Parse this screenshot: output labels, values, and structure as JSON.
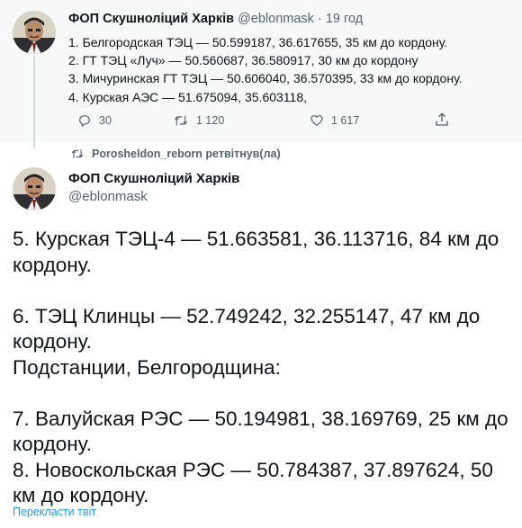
{
  "tweet1": {
    "display_name": "ФОП Скушноліций Харків",
    "handle": "@eblonmask",
    "separator": "·",
    "time": "19 год",
    "lines": [
      "1. Белгородская ТЭЦ — 50.599187, 36.617655, 35 км до кордону.",
      "2. ГТ ТЭЦ «Луч» — 50.560687, 36.580917, 30 км до кордону",
      "3. Мичуринская ГТ ТЭЦ — 50.606040, 36.570395, 33 км до кордону.",
      "4. Курская АЭС — 51.675094, 35.603118,"
    ],
    "actions": {
      "reply_count": "30",
      "retweet_count": "1 120",
      "like_count": "1 617"
    }
  },
  "retweet_banner": {
    "text": "Porosheldon_reborn ретвітнув(ла)",
    "icon": "retweet-icon"
  },
  "tweet2": {
    "display_name": "ФОП Скушноліций Харків",
    "handle": "@eblonmask",
    "paragraphs": [
      "5. Курская ТЭЦ-4 — 51.663581, 36.113716,  84 км до кордону.",
      "",
      "6. ТЭЦ Клинцы — 52.749242, 32.255147, 47 км до кордону.",
      "Подстанции, Белгородщина:",
      "",
      "7. Валуйская РЭС — 50.194981, 38.169769, 25 км до кордону.",
      "8. Новоскольская РЭС — 50.784387, 37.897624, 50 км до кордону."
    ],
    "translate_label": "Перекласти твіт"
  },
  "colors": {
    "accent": "#1d9bf0",
    "muted": "#536471",
    "text": "#0f1419",
    "top_bg": "#f7f9f9"
  }
}
